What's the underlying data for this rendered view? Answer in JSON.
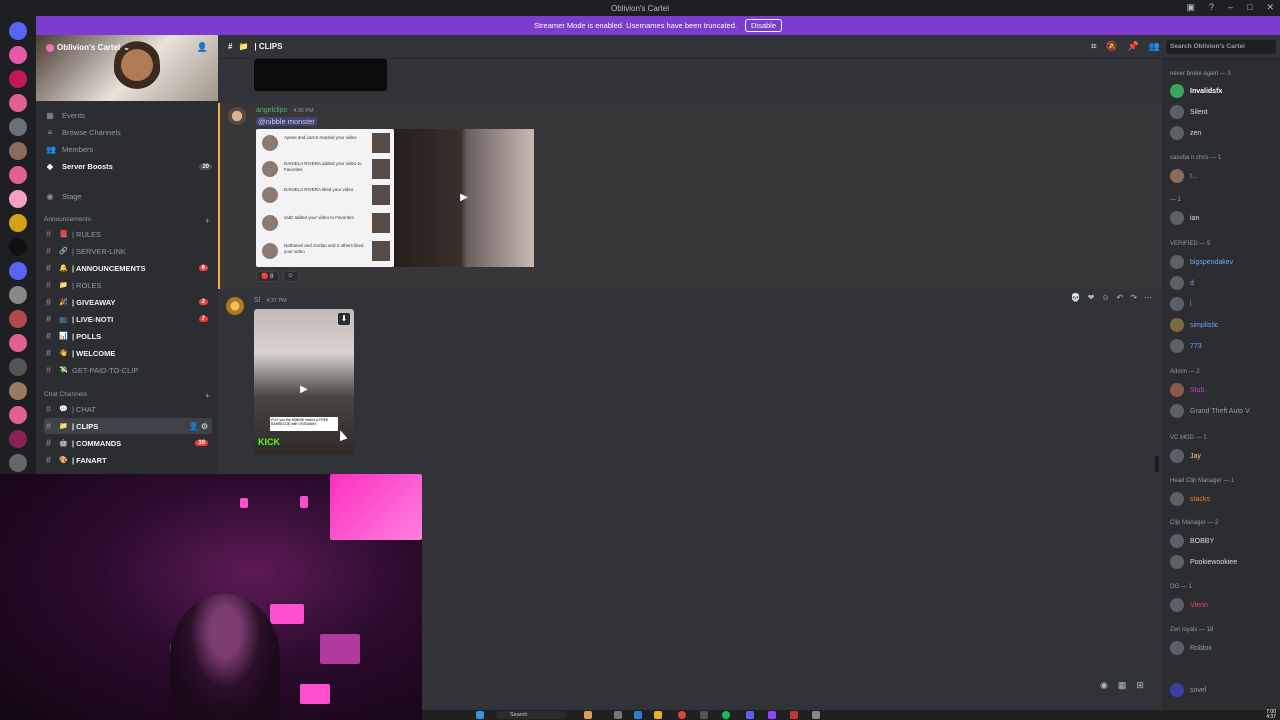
{
  "window": {
    "title": "Oblivion's Cartel"
  },
  "banner": {
    "text": "Streamer Mode is enabled. Usernames have been truncated.",
    "button": "Disable"
  },
  "server": {
    "name": "Oblivion's Cartel",
    "menu": [
      {
        "label": "Events",
        "icon": "calendar-icon"
      },
      {
        "label": "Browse Channels",
        "icon": "browse-icon"
      },
      {
        "label": "Members",
        "icon": "members-icon"
      },
      {
        "label": "Server Boosts",
        "icon": "boost-icon",
        "badge": "20"
      }
    ],
    "stage": "Stage",
    "categories": [
      {
        "name": "Announcements",
        "channels": [
          {
            "name": "| RULES",
            "emoji": "📕",
            "unread": false
          },
          {
            "name": "| SERVER-LINK",
            "emoji": "🔗",
            "unread": false
          },
          {
            "name": "| ANNOUNCEMENTS",
            "emoji": "🔔",
            "unread": true,
            "badge": "6"
          },
          {
            "name": "| ROLES",
            "emoji": "📁",
            "unread": false
          },
          {
            "name": "| GIVEAWAY",
            "emoji": "🎉",
            "unread": true,
            "badge": "2"
          },
          {
            "name": "| LIVE-NOTI",
            "emoji": "📺",
            "unread": true,
            "badge": "7"
          },
          {
            "name": "| POLLS",
            "emoji": "📊",
            "unread": true
          },
          {
            "name": "| WELCOME",
            "emoji": "👋",
            "unread": true
          },
          {
            "name": "GET-PAID-TO-CLIP",
            "emoji": "💸",
            "unread": false
          }
        ]
      },
      {
        "name": "Chat Channels",
        "channels": [
          {
            "name": "| CHAT",
            "emoji": "💬",
            "unread": false
          },
          {
            "name": "| CLIPS",
            "emoji": "📁",
            "unread": true,
            "active": true
          },
          {
            "name": "| COMMANDS",
            "emoji": "🤖",
            "unread": true,
            "badge": "10"
          },
          {
            "name": "| FANART",
            "emoji": "🎨",
            "unread": true
          }
        ]
      }
    ]
  },
  "channel": {
    "name": "| CLIPS",
    "search_placeholder": "Search Oblivion's Cartel"
  },
  "messages": [
    {
      "author": "angelclips",
      "time": "4:36 PM",
      "mention": "@nibble monster",
      "notifications": [
        "Ayeee and carrot reacted your video",
        "DANIELA RIVERA added your video to Favorites",
        "DANIELA RIVERA liked your video",
        "saltz added your video to Favorites",
        "Nathaniel and Jordan and 2 others liked your video"
      ],
      "reactions": [
        {
          "emoji": "🔴",
          "count": "8"
        },
        {
          "emoji": "☺",
          "count": ""
        }
      ]
    },
    {
      "author": "Sl",
      "time": "4:37 PM",
      "clip_brand": "KICK",
      "clip_caption": "POV you the MINNIE invited a FREE BARBECUE with GIVEAWAY"
    }
  ],
  "members": {
    "groups": [
      {
        "role": "never broke again — 3",
        "users": [
          "Invalidsfx",
          "Silent",
          "zen"
        ]
      },
      {
        "role": "caseba n chris — 1",
        "users": [
          "t..."
        ]
      },
      {
        "role": "— 1",
        "users": [
          "ian"
        ]
      },
      {
        "role": "VERIFIED — 5",
        "users": [
          "bigspendakev",
          "d",
          "l",
          "simplistic",
          "773"
        ]
      },
      {
        "role": "Admin — 2",
        "users": [
          "Stub",
          "Grand Theft Auto V"
        ]
      },
      {
        "role": "VC MOD — 1",
        "users": [
          "Jay"
        ]
      },
      {
        "role": "Head Clip Manager — 1",
        "users": [
          "stacks"
        ]
      },
      {
        "role": "Clip Manager — 2",
        "users": [
          "BOBBY",
          "Pookiewookiee"
        ]
      },
      {
        "role": "OG — 1",
        "users": [
          "Vlenn"
        ]
      },
      {
        "role": "Zen loyals — 18",
        "users": [
          "Roblox",
          "",
          "sovel"
        ]
      }
    ]
  },
  "taskbar": {
    "search": "Search",
    "time": "7:00",
    "date": "4:37"
  },
  "colors": {
    "accent": "#7b3ccf",
    "unread_badge": "#f23f43",
    "online": "#43b581",
    "kick": "#53fc18"
  }
}
